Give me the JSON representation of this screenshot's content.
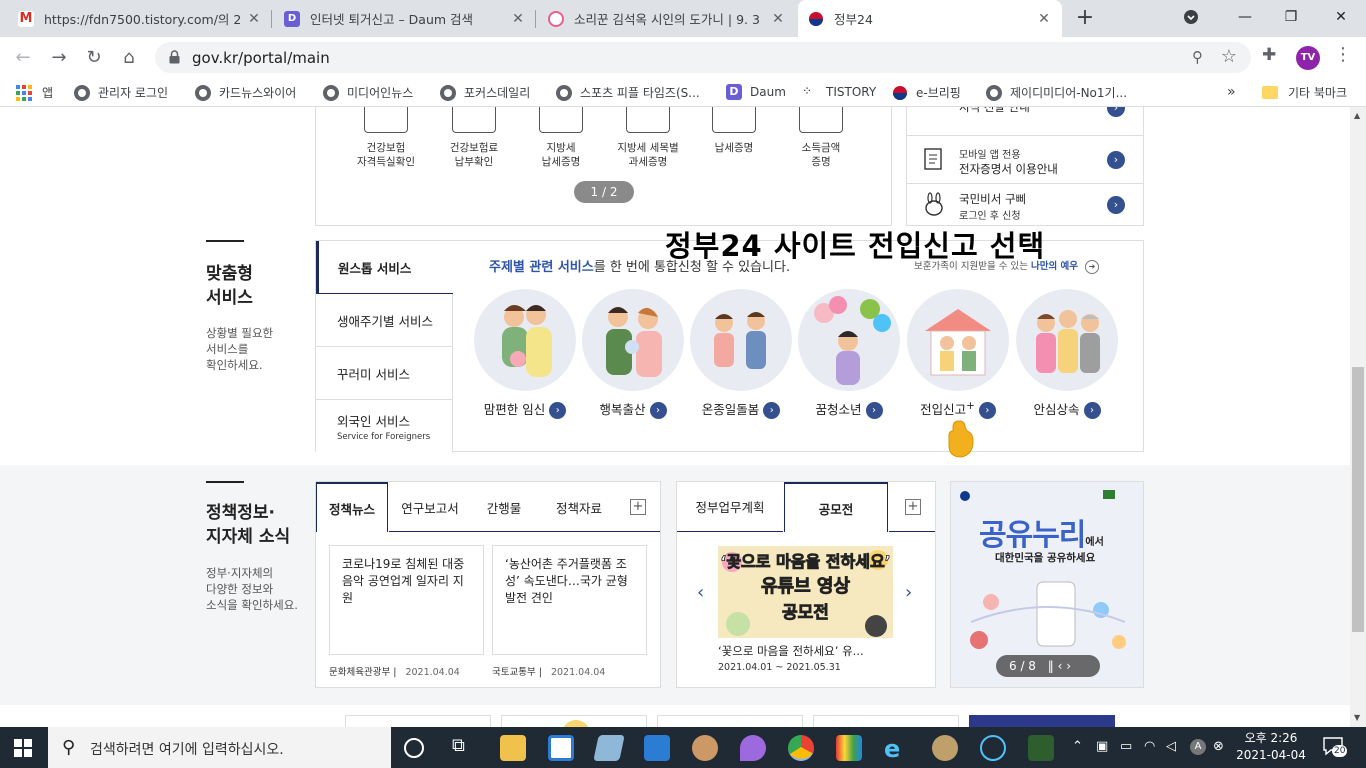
{
  "browser": {
    "tabs": [
      {
        "title": "https://fdn7500.tistory.com/의 2월",
        "favicon": "gmail-icon",
        "active": false
      },
      {
        "title": "인터넷 퇴거신고 – Daum 검색",
        "favicon": "daum-icon",
        "active": false
      },
      {
        "title": "소리꾼 김석옥 시인의 도가니 | 9. 3",
        "favicon": "blog-icon",
        "active": false
      },
      {
        "title": "정부24",
        "favicon": "gov24-icon",
        "active": true
      }
    ],
    "url": "gov.kr/portal/main",
    "profile_initials": "TV",
    "bookmarks": [
      "앱",
      "관리자 로그인",
      "카드뉴스와이어",
      "미디어인뉴스",
      "포커스데일리",
      "스포츠 피플 타임즈(S...",
      "Daum",
      "TISTORY",
      "e-브리핑",
      "제이디미디어-No1기..."
    ],
    "more_bookmarks": "»",
    "other_bookmarks": "기타 북마크"
  },
  "top_docs": {
    "items": [
      "건강보험\n자격득실확인",
      "건강보험료\n납부확인",
      "지방세\n납세증명",
      "지방세 세목별\n과세증명",
      "납세증명",
      "소득금액\n증명"
    ],
    "pager": "1 / 2"
  },
  "right_list": {
    "items": [
      {
        "line1": "",
        "line2": "지식 전달 안내"
      },
      {
        "line1": "모바일 앱 전용",
        "line2": "전자증명서 이용안내"
      },
      {
        "line1": "국민비서 구삐",
        "line2": "로그인 후 신청"
      }
    ]
  },
  "custom_section": {
    "title": "맞춤형\n서비스",
    "desc": "상황별 필요한\n서비스를\n확인하세요.",
    "tabs": [
      {
        "label": "원스톱 서비스",
        "sub": ""
      },
      {
        "label": "생애주기별 서비스",
        "sub": ""
      },
      {
        "label": "꾸러미 서비스",
        "sub": ""
      },
      {
        "label": "외국인 서비스",
        "sub": "Service for Foreigners"
      }
    ],
    "tagline_hl": "주제별 관련 서비스",
    "tagline_rest": "를 한 번에 통합신청 할 수 있습니다.",
    "my_example_prefix": "보훈가족이 지원받을 수 있는",
    "my_example_hl": "나만의 예우",
    "services": [
      "맘편한 임신",
      "행복출산",
      "온종일돌봄",
      "꿈청소년",
      "전입신고",
      "안심상속"
    ],
    "service_plus": "+",
    "overlay_title": "정부24 사이트 전입신고 선택"
  },
  "policy_section": {
    "title": "정책정보·\n지자체 소식",
    "desc": "정부·지자체의\n다양한 정보와\n소식을 확인하세요.",
    "news_tabs": [
      "정책뉴스",
      "연구보고서",
      "간행물",
      "정책자료"
    ],
    "news": [
      {
        "text": "코로나19로 침체된 대중음악 공연업계 일자리 지원",
        "source": "문화체육관광부",
        "date": "2021.04.04"
      },
      {
        "text": "‘농산어촌 주거플랫폼 조성’ 속도낸다…국가 균형발전 견인",
        "source": "국토교통부",
        "date": "2021.04.04"
      }
    ],
    "contest_tabs": [
      "정부업무계획",
      "공모전"
    ],
    "contest": {
      "poster_lines": [
        "‘꽃으로 마음을 전하세요’",
        "유튜브 영상",
        "공모전"
      ],
      "caption": "‘꽃으로 마음을 전하세요’ 유...",
      "date": "2021.04.01 ~ 2021.05.31"
    },
    "banner": {
      "headline": "공유누리",
      "headline_suffix": "에서",
      "sub": "대한민국을 공유하세요",
      "pager": "6 / 8"
    }
  },
  "taskbar": {
    "search_placeholder": "검색하려면 여기에 입력하십시오.",
    "time": "오후 2:26",
    "date": "2021-04-04",
    "notifications": "20",
    "ime": "A"
  },
  "colors": {
    "navy": "#1b2a5c",
    "accent_blue": "#2e55a7",
    "button_blue": "#35508f"
  }
}
